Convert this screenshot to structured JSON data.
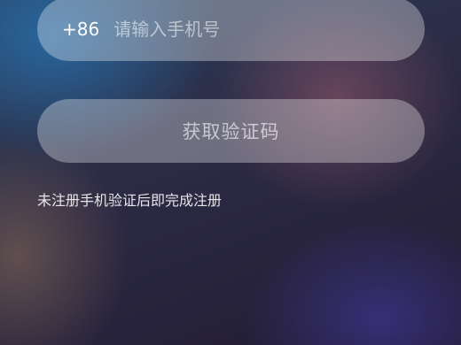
{
  "form": {
    "country_code": "+86",
    "phone_placeholder": "请输入手机号",
    "phone_value": "",
    "get_code_label": "获取验证码",
    "hint": "未注册手机验证后即完成注册"
  }
}
